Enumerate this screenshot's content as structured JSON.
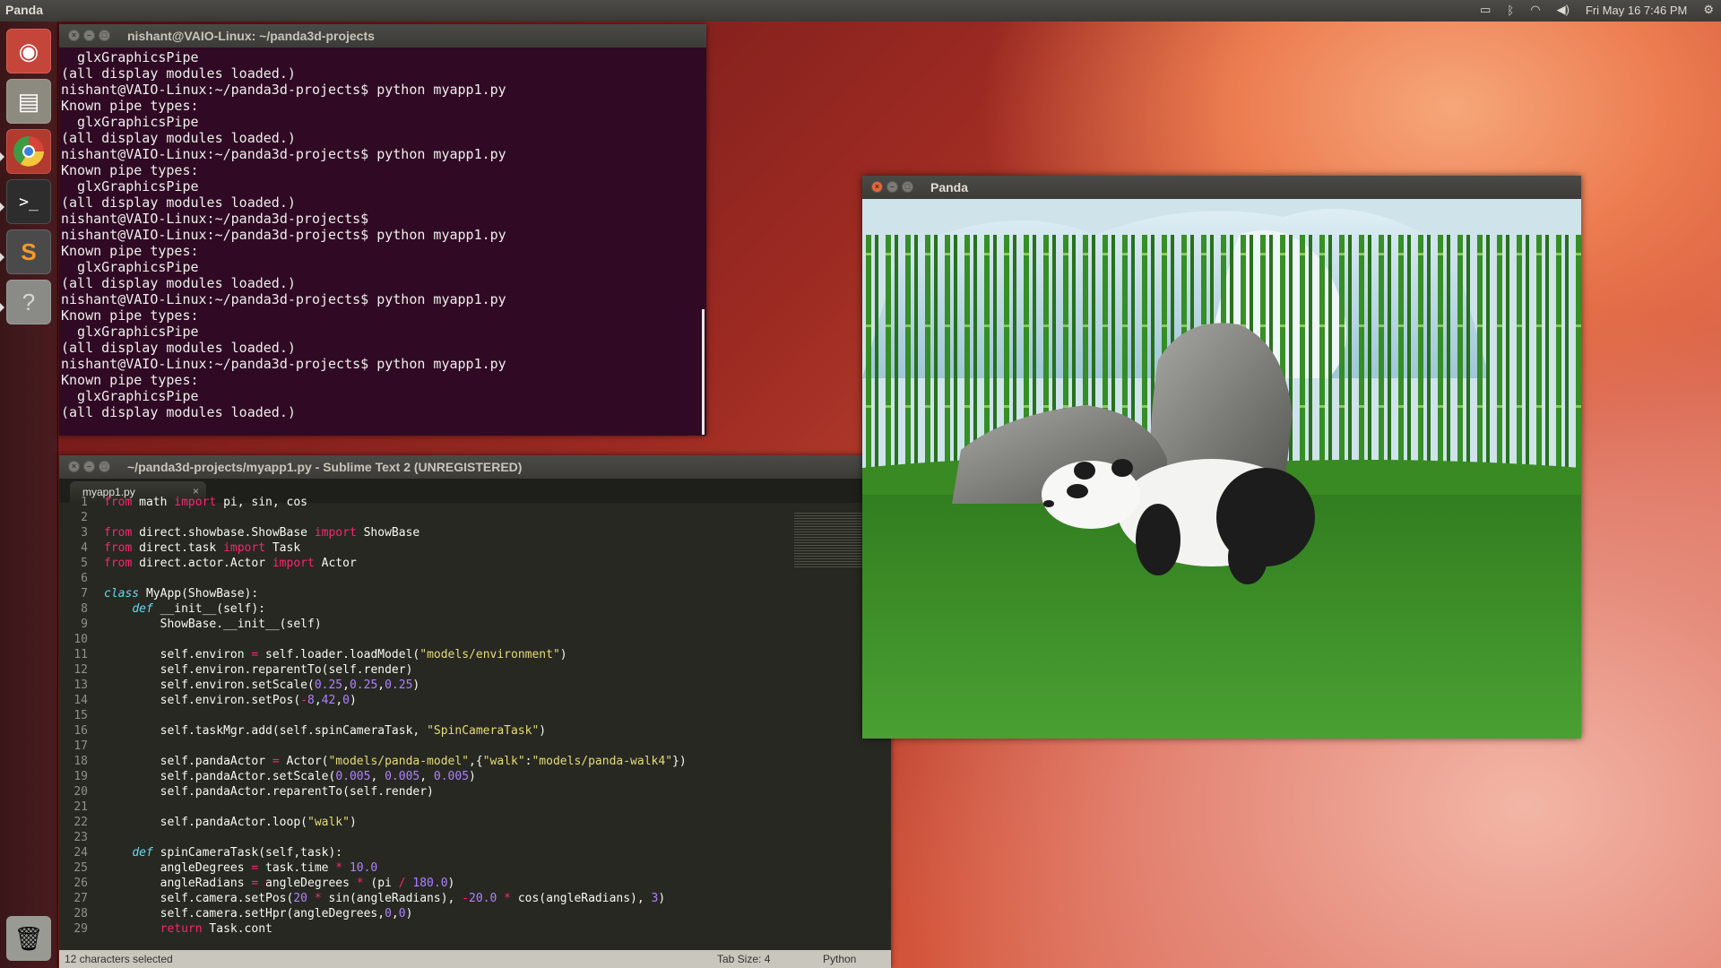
{
  "panel": {
    "app_title": "Panda",
    "datetime": "Fri May 16  7:46 PM",
    "icons": [
      "battery-icon",
      "bluetooth-icon",
      "wifi-icon",
      "volume-icon",
      "gear-icon"
    ]
  },
  "launcher": {
    "items": [
      "ubuntu-dash",
      "files",
      "chrome",
      "terminal",
      "sublime-text",
      "help",
      "trash"
    ]
  },
  "terminal": {
    "title": "nishant@VAIO-Linux: ~/panda3d-projects",
    "lines": [
      "  glxGraphicsPipe",
      "(all display modules loaded.)",
      "nishant@VAIO-Linux:~/panda3d-projects$ python myapp1.py",
      "Known pipe types:",
      "  glxGraphicsPipe",
      "(all display modules loaded.)",
      "nishant@VAIO-Linux:~/panda3d-projects$ python myapp1.py",
      "Known pipe types:",
      "  glxGraphicsPipe",
      "(all display modules loaded.)",
      "nishant@VAIO-Linux:~/panda3d-projects$",
      "nishant@VAIO-Linux:~/panda3d-projects$ python myapp1.py",
      "Known pipe types:",
      "  glxGraphicsPipe",
      "(all display modules loaded.)",
      "nishant@VAIO-Linux:~/panda3d-projects$ python myapp1.py",
      "Known pipe types:",
      "  glxGraphicsPipe",
      "(all display modules loaded.)",
      "nishant@VAIO-Linux:~/panda3d-projects$ python myapp1.py",
      "Known pipe types:",
      "  glxGraphicsPipe",
      "(all display modules loaded.)"
    ]
  },
  "sublime": {
    "title": "~/panda3d-projects/myapp1.py - Sublime Text 2 (UNREGISTERED)",
    "tab_label": "myapp1.py",
    "tab_close": "×",
    "status_left": "12 characters selected",
    "status_tab": "Tab Size: 4",
    "status_syntax": "Python",
    "code": [
      {
        "n": "1",
        "t": "from math import pi, sin, cos"
      },
      {
        "n": "2",
        "t": ""
      },
      {
        "n": "3",
        "t": "from direct.showbase.ShowBase import ShowBase"
      },
      {
        "n": "4",
        "t": "from direct.task import Task"
      },
      {
        "n": "5",
        "t": "from direct.actor.Actor import Actor"
      },
      {
        "n": "6",
        "t": ""
      },
      {
        "n": "7",
        "t": "class MyApp(ShowBase):"
      },
      {
        "n": "8",
        "t": "    def __init__(self):"
      },
      {
        "n": "9",
        "t": "        ShowBase.__init__(self)"
      },
      {
        "n": "10",
        "t": ""
      },
      {
        "n": "11",
        "t": "        self.environ = self.loader.loadModel(\"models/environment\")"
      },
      {
        "n": "12",
        "t": "        self.environ.reparentTo(self.render)"
      },
      {
        "n": "13",
        "t": "        self.environ.setScale(0.25,0.25,0.25)"
      },
      {
        "n": "14",
        "t": "        self.environ.setPos(-8,42,0)"
      },
      {
        "n": "15",
        "t": ""
      },
      {
        "n": "16",
        "t": "        self.taskMgr.add(self.spinCameraTask, \"SpinCameraTask\")"
      },
      {
        "n": "17",
        "t": ""
      },
      {
        "n": "18",
        "t": "        self.pandaActor = Actor(\"models/panda-model\",{\"walk\":\"models/panda-walk4\"})"
      },
      {
        "n": "19",
        "t": "        self.pandaActor.setScale(0.005, 0.005, 0.005)"
      },
      {
        "n": "20",
        "t": "        self.pandaActor.reparentTo(self.render)"
      },
      {
        "n": "21",
        "t": ""
      },
      {
        "n": "22",
        "t": "        self.pandaActor.loop(\"walk\")"
      },
      {
        "n": "23",
        "t": ""
      },
      {
        "n": "24",
        "t": "    def spinCameraTask(self,task):"
      },
      {
        "n": "25",
        "t": "        angleDegrees = task.time * 10.0"
      },
      {
        "n": "26",
        "t": "        angleRadians = angleDegrees * (pi / 180.0)"
      },
      {
        "n": "27",
        "t": "        self.camera.setPos(20 * sin(angleRadians), -20.0 * cos(angleRadians), 3)"
      },
      {
        "n": "28",
        "t": "        self.camera.setHpr(angleDegrees,0,0)"
      },
      {
        "n": "29",
        "t": "        return Task.cont"
      }
    ]
  },
  "panda_window": {
    "title": "Panda"
  },
  "colors": {
    "terminal_bg": "#300a24",
    "editor_bg": "#272822",
    "keyword": "#f92672",
    "string": "#e6db74",
    "number": "#ae81ff",
    "function": "#a6e22e"
  }
}
